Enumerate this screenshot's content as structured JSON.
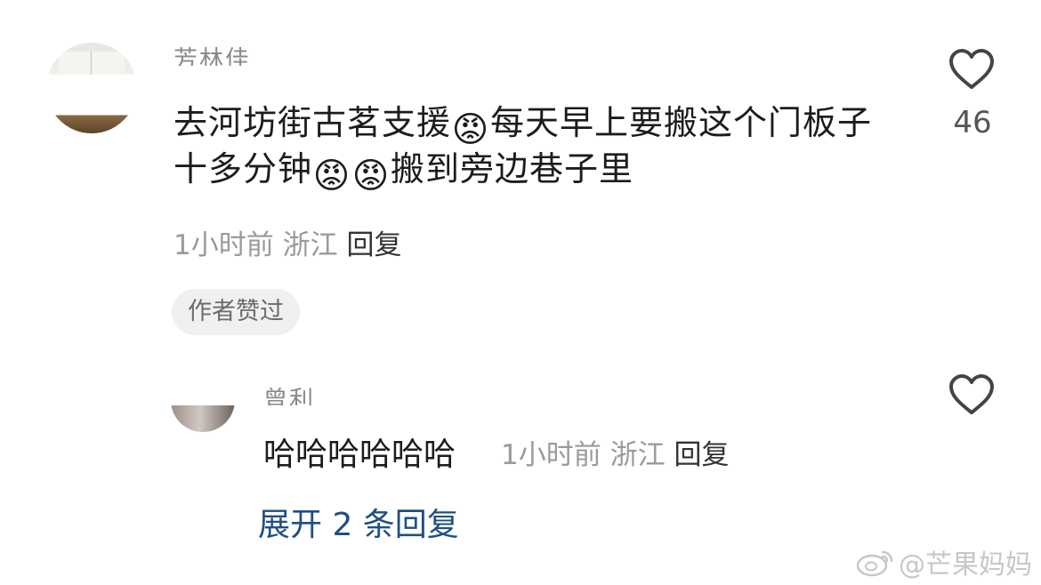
{
  "comments": [
    {
      "username": "芳林佳",
      "text_part1": "去河坊街古茗支援",
      "text_part2": "每天早上要搬这个门板子十多分钟",
      "text_part3": "搬到旁边巷子里",
      "emoji": "😡",
      "time": "1小时前",
      "location": "浙江",
      "reply_label": "回复",
      "badge": "作者赞过",
      "like_count": "46"
    },
    {
      "username": "曾利",
      "text": "哈哈哈哈哈哈",
      "time": "1小时前",
      "location": "浙江",
      "reply_label": "回复"
    }
  ],
  "expand_label": "展开 2 条回复",
  "watermark": "@芒果妈妈",
  "colors": {
    "link": "#1f4f82",
    "meta": "#9a9a9a",
    "badge_bg": "#f0f0f0"
  }
}
